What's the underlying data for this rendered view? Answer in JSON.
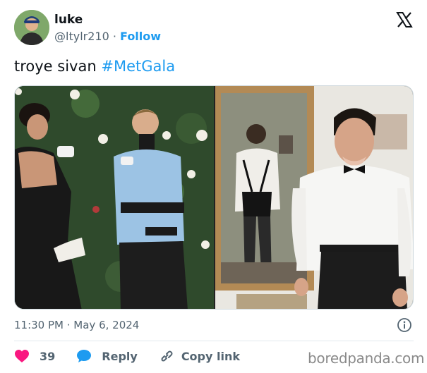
{
  "user": {
    "display_name": "luke",
    "handle": "@ltylr210",
    "separator": "·",
    "follow_label": "Follow"
  },
  "tweet": {
    "text": "troye sivan",
    "hashtag": "#MetGala"
  },
  "meta": {
    "timestamp": "11:30 PM · May 6, 2024"
  },
  "actions": {
    "like_count": "39",
    "reply_label": "Reply",
    "copy_label": "Copy link"
  },
  "watermark": "boredpanda.com",
  "colors": {
    "accent": "#1d9bf0",
    "like": "#f91880",
    "text_secondary": "#536471"
  },
  "icons": {
    "logo": "x-logo-icon",
    "info": "info-icon",
    "like": "heart-icon",
    "reply": "speech-bubble-icon",
    "copy": "link-icon"
  }
}
